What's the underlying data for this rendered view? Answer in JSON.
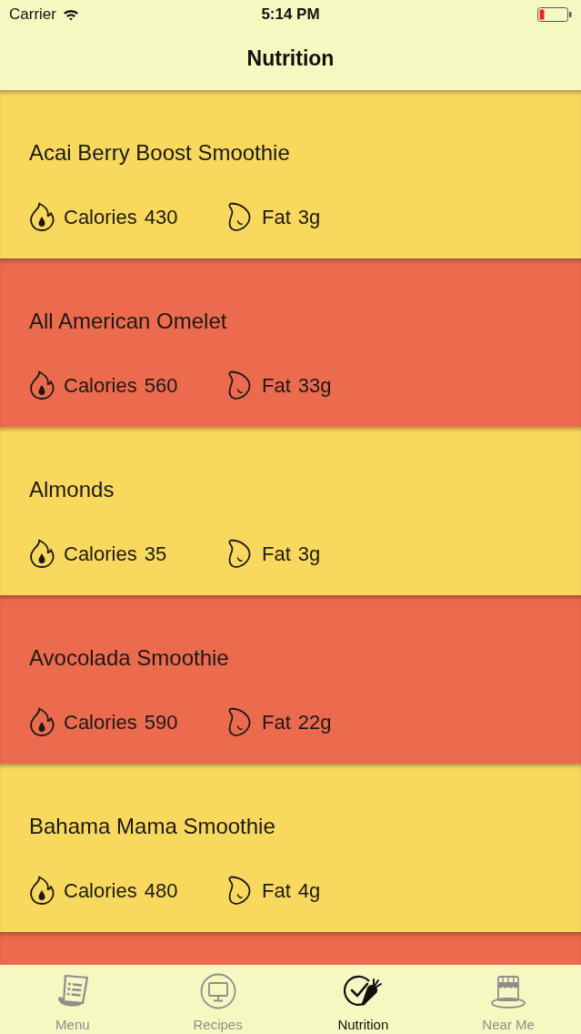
{
  "status_bar": {
    "carrier": "Carrier",
    "time": "5:14 PM"
  },
  "nav": {
    "title": "Nutrition"
  },
  "items": [
    {
      "name": "Acai Berry Boost Smoothie",
      "calories_label": "Calories",
      "calories": "430",
      "fat_label": "Fat",
      "fat": "3g",
      "color": "#f9d85e"
    },
    {
      "name": "All American Omelet",
      "calories_label": "Calories",
      "calories": "560",
      "fat_label": "Fat",
      "fat": "33g",
      "color": "#ec6a4d"
    },
    {
      "name": "Almonds",
      "calories_label": "Calories",
      "calories": "35",
      "fat_label": "Fat",
      "fat": "3g",
      "color": "#f9d85e"
    },
    {
      "name": "Avocolada Smoothie",
      "calories_label": "Calories",
      "calories": "590",
      "fat_label": "Fat",
      "fat": "22g",
      "color": "#ec6a4d"
    },
    {
      "name": "Bahama Mama Smoothie",
      "calories_label": "Calories",
      "calories": "480",
      "fat_label": "Fat",
      "fat": "4g",
      "color": "#f9d85e"
    },
    {
      "color": "#ec6a4d"
    }
  ],
  "tabs": [
    {
      "label": "Menu",
      "selected": false
    },
    {
      "label": "Recipes",
      "selected": false
    },
    {
      "label": "Nutrition",
      "selected": true
    },
    {
      "label": "Near Me",
      "selected": false
    }
  ]
}
